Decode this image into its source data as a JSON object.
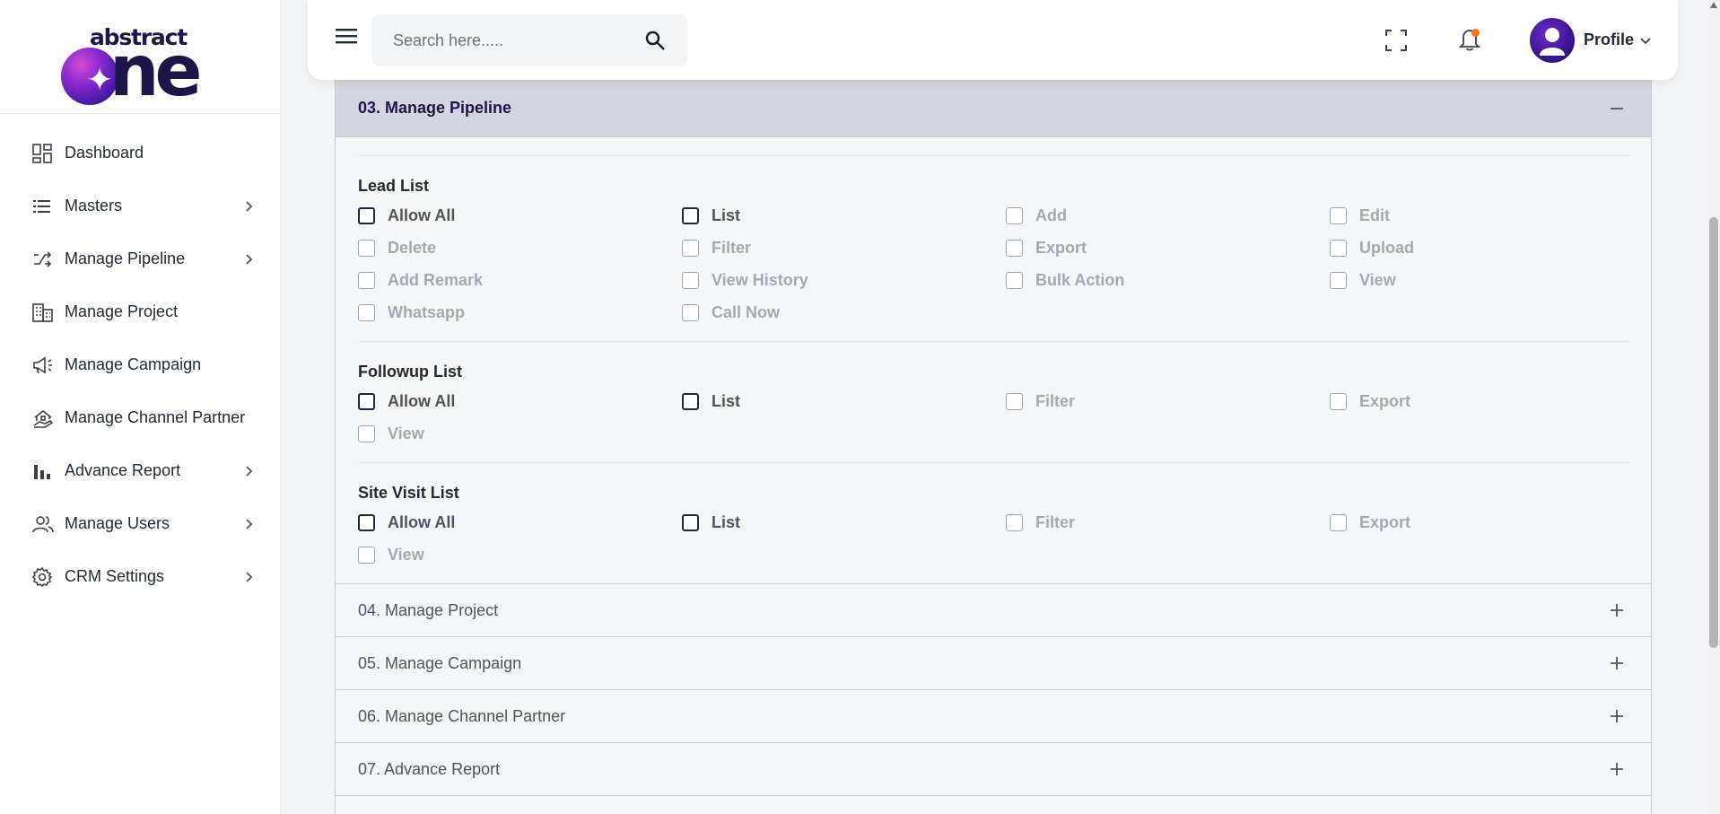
{
  "brand": {
    "word": "abstract",
    "big": "ne",
    "star": "✦"
  },
  "sidebar": {
    "items": [
      {
        "label": "Dashboard",
        "icon": "dashboard-icon",
        "has_chevron": false
      },
      {
        "label": "Masters",
        "icon": "list-icon",
        "has_chevron": true
      },
      {
        "label": "Manage Pipeline",
        "icon": "pipeline-icon",
        "has_chevron": true
      },
      {
        "label": "Manage Project",
        "icon": "building-icon",
        "has_chevron": false
      },
      {
        "label": "Manage Campaign",
        "icon": "megaphone-icon",
        "has_chevron": false
      },
      {
        "label": "Manage Channel Partner",
        "icon": "partner-icon",
        "has_chevron": false
      },
      {
        "label": "Advance Report",
        "icon": "bar-chart-icon",
        "has_chevron": true
      },
      {
        "label": "Manage Users",
        "icon": "users-icon",
        "has_chevron": true
      },
      {
        "label": "CRM Settings",
        "icon": "gear-icon",
        "has_chevron": true
      }
    ]
  },
  "header": {
    "search_placeholder": "Search here.....",
    "profile_label": "Profile",
    "notification_dot_color": "#f97316"
  },
  "accordion": {
    "active": {
      "title": "03. Manage Pipeline",
      "sections": [
        {
          "title": "Lead List",
          "permissions": [
            {
              "label": "Allow All",
              "enabled": true
            },
            {
              "label": "List",
              "enabled": true
            },
            {
              "label": "Add",
              "enabled": false
            },
            {
              "label": "Edit",
              "enabled": false
            },
            {
              "label": "Delete",
              "enabled": false
            },
            {
              "label": "Filter",
              "enabled": false
            },
            {
              "label": "Export",
              "enabled": false
            },
            {
              "label": "Upload",
              "enabled": false
            },
            {
              "label": "Add Remark",
              "enabled": false
            },
            {
              "label": "View History",
              "enabled": false
            },
            {
              "label": "Bulk Action",
              "enabled": false
            },
            {
              "label": "View",
              "enabled": false
            },
            {
              "label": "Whatsapp",
              "enabled": false
            },
            {
              "label": "Call Now",
              "enabled": false
            }
          ]
        },
        {
          "title": "Followup List",
          "permissions": [
            {
              "label": "Allow All",
              "enabled": true
            },
            {
              "label": "List",
              "enabled": true
            },
            {
              "label": "Filter",
              "enabled": false
            },
            {
              "label": "Export",
              "enabled": false
            },
            {
              "label": "View",
              "enabled": false
            }
          ]
        },
        {
          "title": "Site Visit List",
          "permissions": [
            {
              "label": "Allow All",
              "enabled": true
            },
            {
              "label": "List",
              "enabled": true
            },
            {
              "label": "Filter",
              "enabled": false
            },
            {
              "label": "Export",
              "enabled": false
            },
            {
              "label": "View",
              "enabled": false
            }
          ]
        }
      ]
    },
    "collapsed": [
      {
        "title": "04. Manage Project"
      },
      {
        "title": "05. Manage Campaign"
      },
      {
        "title": "06. Manage Channel Partner"
      },
      {
        "title": "07. Advance Report"
      }
    ]
  }
}
